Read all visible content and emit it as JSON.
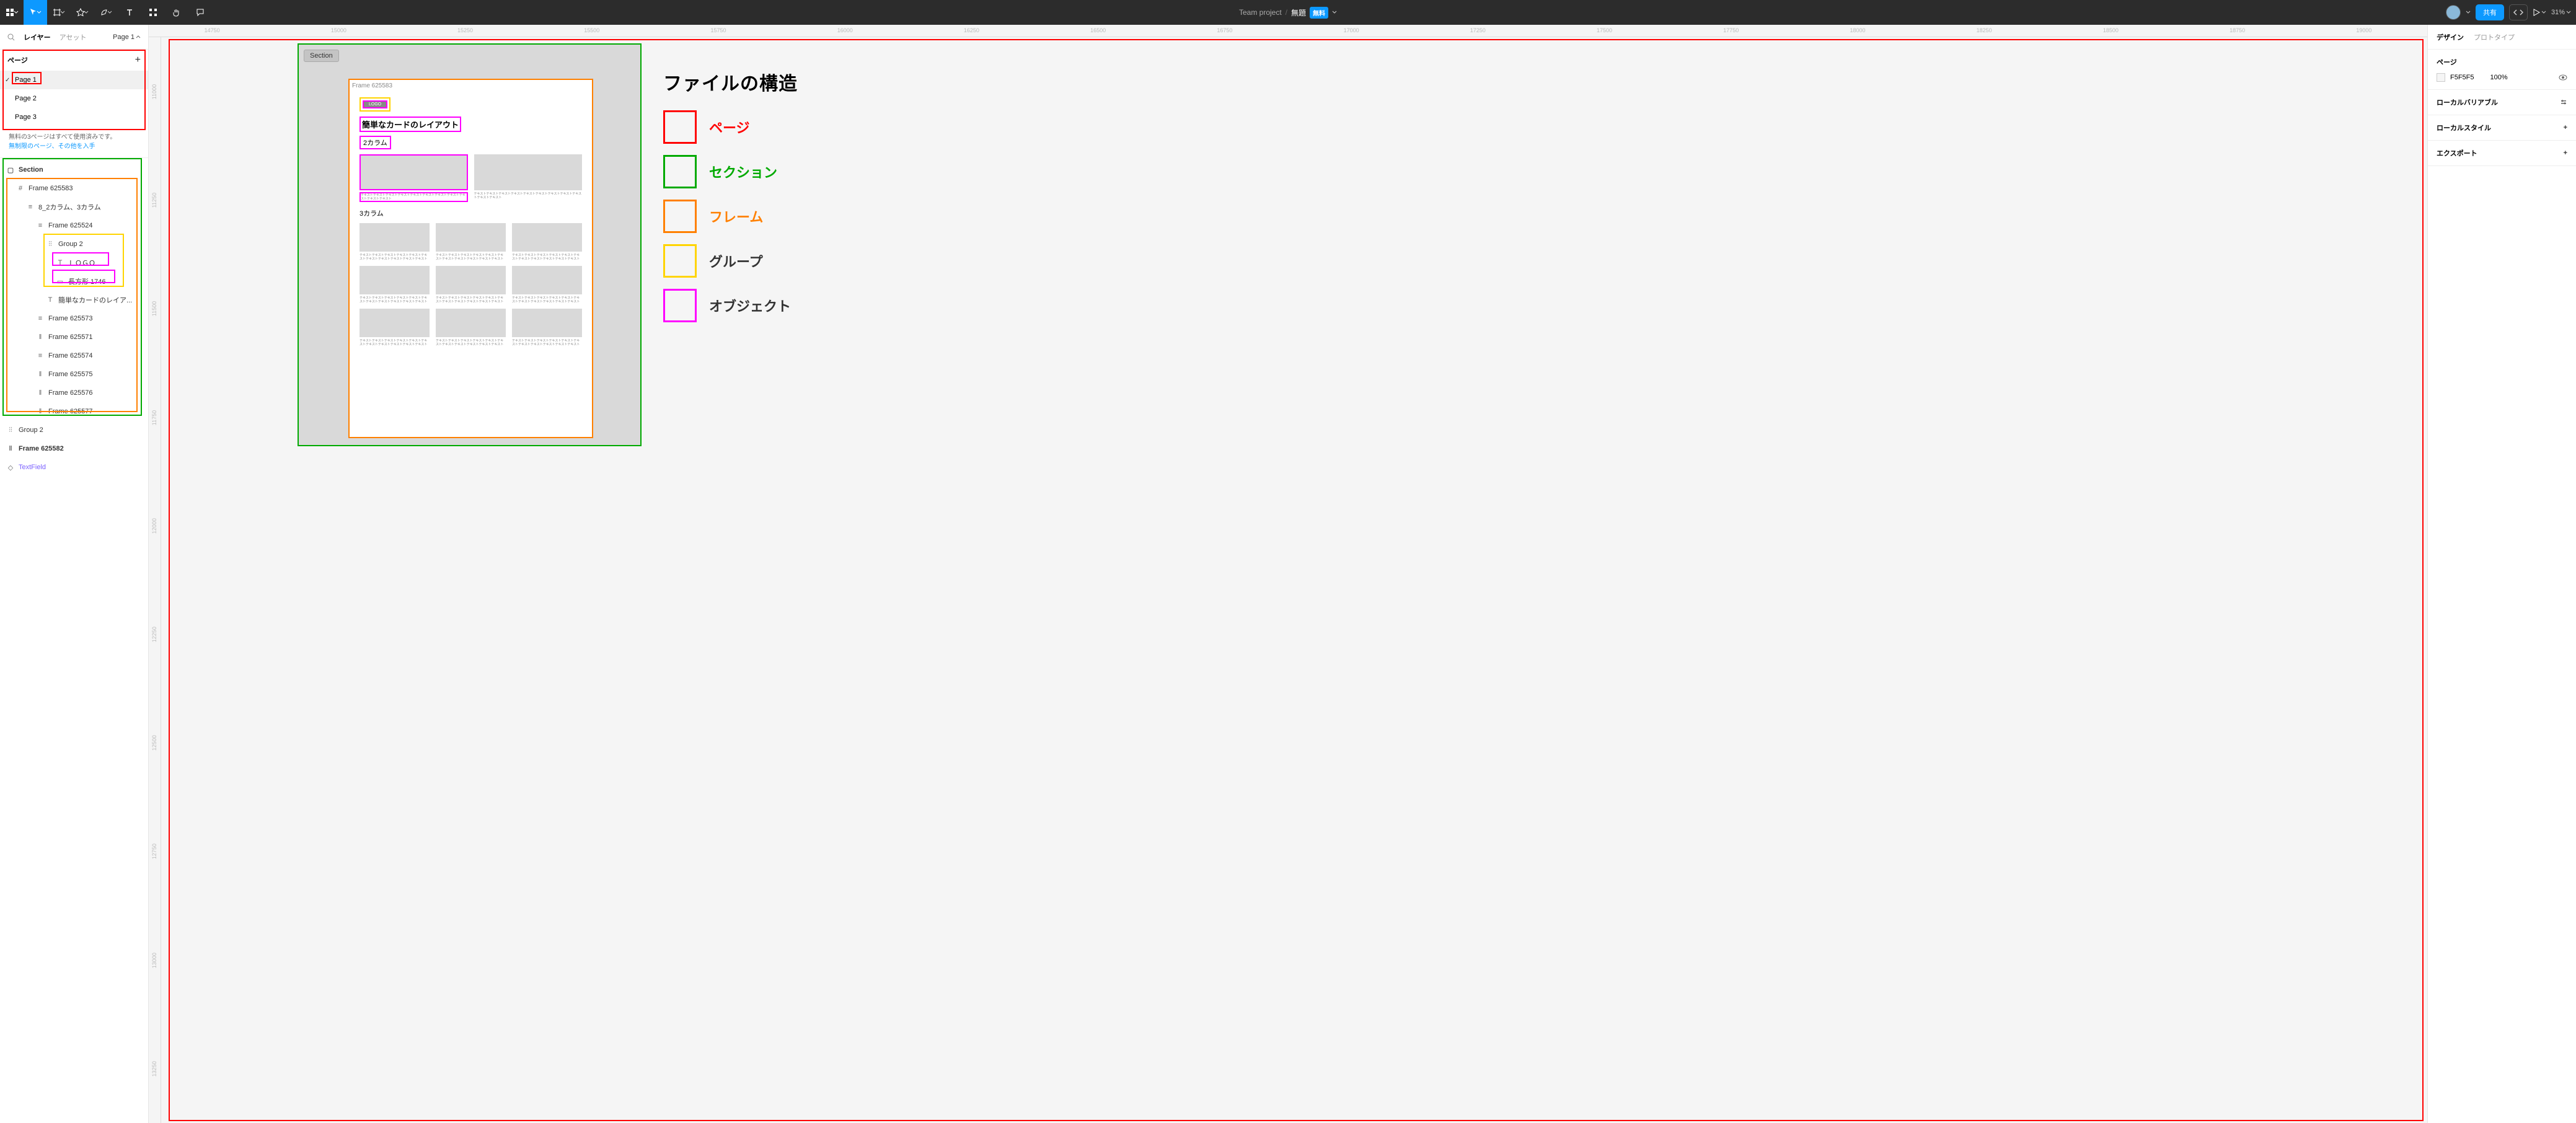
{
  "topbar": {
    "team": "Team project",
    "title": "無題",
    "free_badge": "無料",
    "share": "共有",
    "zoom": "31%"
  },
  "left_panel": {
    "tab_layers": "レイヤー",
    "tab_assets": "アセット",
    "page_indicator": "Page 1",
    "pages_header": "ページ",
    "pages": [
      "Page 1",
      "Page 2",
      "Page 3"
    ],
    "pages_msg": "無料の3ページはすべて使用済みです。",
    "pages_link": "無制限のページ、その他を入手",
    "layers": {
      "section": "Section",
      "frame_main": "Frame 625583",
      "layout": "8_2カラム、3カラム",
      "frame524": "Frame 625524",
      "group2": "Group 2",
      "logo": "ＬＯＧＯ",
      "rect": "長方形 1746",
      "card_title": "簡単なカードのレイア...",
      "f573": "Frame 625573",
      "f571": "Frame 625571",
      "f574": "Frame 625574",
      "f575": "Frame 625575",
      "f576": "Frame 625576",
      "f577": "Frame 625577",
      "group2b": "Group 2",
      "f582": "Frame 625582",
      "textfield": "TextField"
    }
  },
  "ruler_h": [
    "14750",
    "15000",
    "15250",
    "15500",
    "15750",
    "16000",
    "16250",
    "16500",
    "16750",
    "17000",
    "17250",
    "17500",
    "17750",
    "18000",
    "18250",
    "18500",
    "18750",
    "19000"
  ],
  "ruler_v": [
    "11000",
    "11250",
    "11500",
    "11750",
    "12000",
    "12250",
    "12500",
    "12750",
    "13000",
    "13250"
  ],
  "canvas": {
    "section_label": "Section",
    "frame_label": "Frame 625583",
    "logo": "LOGO",
    "h1": "簡単なカードのレイアウト",
    "h2": "2カラム",
    "h3": "3カラム",
    "lorem": "テキストテキストテキストテキストテキストテキストテキストテキストテキストテキストテキスト"
  },
  "legend": {
    "title": "ファイルの構造",
    "items": [
      {
        "color": "#f00",
        "label": "ページ",
        "cls": "lr"
      },
      {
        "color": "#0a0",
        "label": "セクション",
        "cls": "lg"
      },
      {
        "color": "#ff8000",
        "label": "フレーム",
        "cls": "lo"
      },
      {
        "color": "#ffd400",
        "label": "グループ",
        "cls": "ly"
      },
      {
        "color": "#f0f",
        "label": "オブジェクト",
        "cls": "lm"
      }
    ]
  },
  "right_panel": {
    "tab_design": "デザイン",
    "tab_proto": "プロトタイプ",
    "page_sec": "ページ",
    "bg_hex": "F5F5F5",
    "bg_opacity": "100%",
    "local_vars": "ローカルバリアブル",
    "local_styles": "ローカルスタイル",
    "export": "エクスポート"
  }
}
